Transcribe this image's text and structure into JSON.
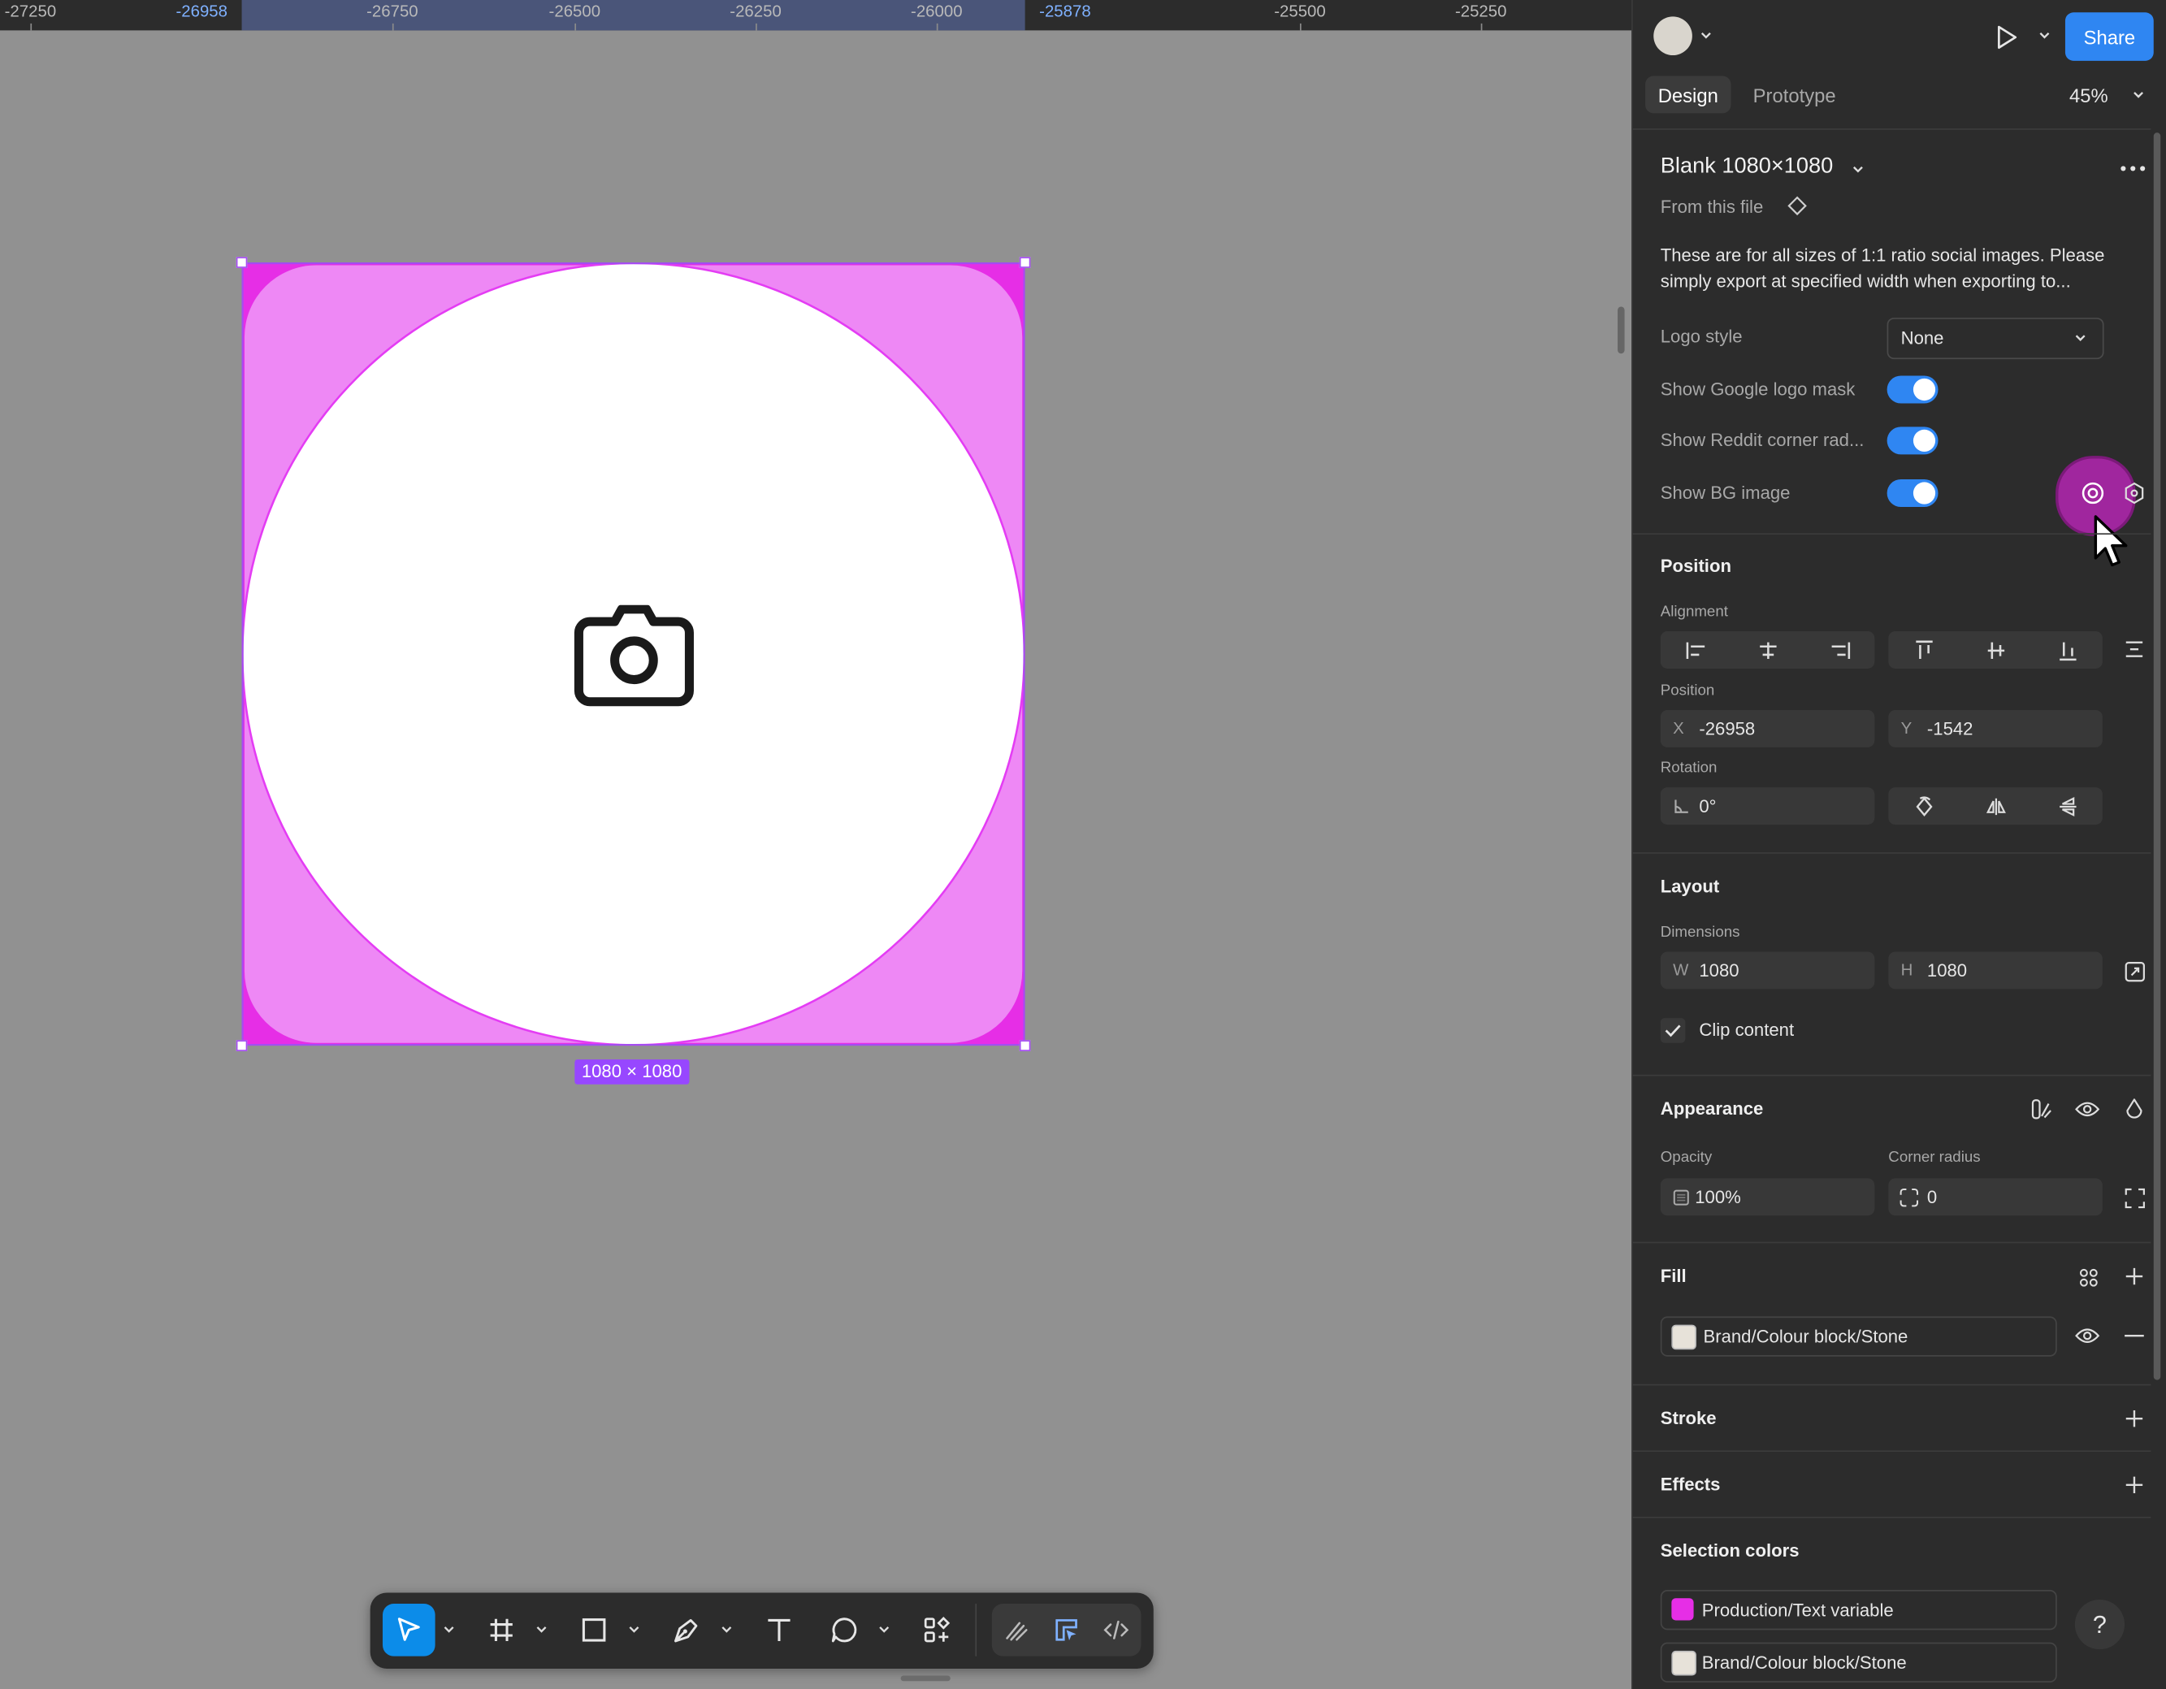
{
  "ruler": {
    "labels": [
      "-27250",
      "-26958",
      "-26750",
      "-26500",
      "-26250",
      "-26000",
      "-25878",
      "-25500",
      "-25250"
    ]
  },
  "canvas": {
    "frame_dimensions": "1080 × 1080",
    "frame_color": "#ee88f5",
    "frame_outline": "#e43cf4"
  },
  "toolbar": {
    "tools": [
      "move-tool",
      "frame-tool",
      "rectangle-tool",
      "pen-tool",
      "text-tool",
      "comment-tool",
      "actions-tool"
    ],
    "modes": [
      "draw-mode",
      "design-mode",
      "dev-mode"
    ]
  },
  "header": {
    "share_label": "Share",
    "tabs": [
      "Design",
      "Prototype"
    ],
    "zoom": "45%"
  },
  "component": {
    "name": "Blank 1080×1080",
    "source": "From this file",
    "description_line1": "These are for all sizes of 1:1 ratio social images. Please",
    "description_line2": "simply export at specified width when exporting to...",
    "properties": {
      "logo_style_label": "Logo style",
      "logo_style_value": "None",
      "google_mask_label": "Show Google logo mask",
      "reddit_label": "Show Reddit corner rad...",
      "bg_image_label": "Show BG image"
    }
  },
  "position": {
    "title": "Position",
    "alignment_label": "Alignment",
    "position_label": "Position",
    "x_prefix": "X",
    "x_value": "-26958",
    "y_prefix": "Y",
    "y_value": "-1542",
    "rotation_label": "Rotation",
    "rotation_value": "0°"
  },
  "layout": {
    "title": "Layout",
    "dimensions_label": "Dimensions",
    "w_prefix": "W",
    "w_value": "1080",
    "h_prefix": "H",
    "h_value": "1080",
    "clip_label": "Clip content"
  },
  "appearance": {
    "title": "Appearance",
    "opacity_label": "Opacity",
    "opacity_value": "100%",
    "radius_label": "Corner radius",
    "radius_value": "0"
  },
  "fill": {
    "title": "Fill",
    "name": "Brand/Colour block/Stone",
    "swatch": "#e7e2d9"
  },
  "stroke": {
    "title": "Stroke"
  },
  "effects": {
    "title": "Effects"
  },
  "selection_colors": {
    "title": "Selection colors",
    "items": [
      {
        "name": "Production/Text variable",
        "color": "#e62ee6"
      },
      {
        "name": "Brand/Colour block/Stone",
        "color": "#e7e2d9"
      }
    ]
  },
  "help_label": "?"
}
